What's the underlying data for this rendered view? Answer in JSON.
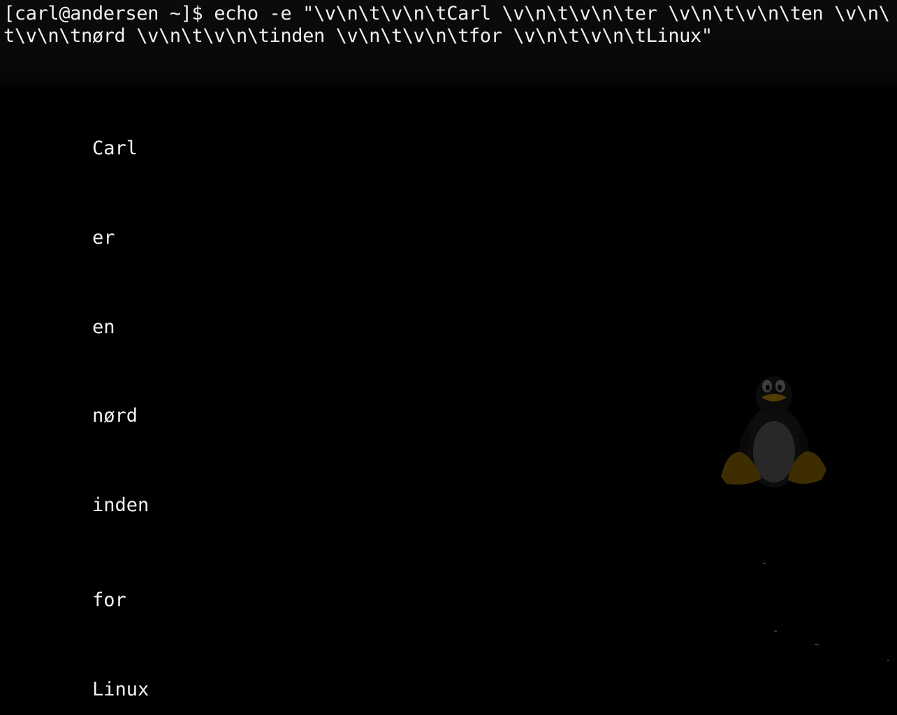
{
  "terminal": {
    "command_line_1": "[carl@andersen ~]$ echo -e \"\\v\\n\\t\\v\\n\\tCarl \\v\\n\\t\\v\\n\\ter \\v\\n\\t\\v\\n\\ten \\v\\n\\",
    "command_line_2": "t\\v\\n\\tnørd \\v\\n\\t\\v\\n\\tinden \\v\\n\\t\\v\\n\\tfor \\v\\n\\t\\v\\n\\tLinux\"",
    "output_lines": [
      "Carl",
      "er",
      "en",
      "nørd",
      "inden",
      "for",
      "Linux"
    ]
  },
  "background": {
    "color": "#000000",
    "logo_icon": "tux-penguin-icon"
  },
  "colors": {
    "text": "#f0f0f0"
  }
}
